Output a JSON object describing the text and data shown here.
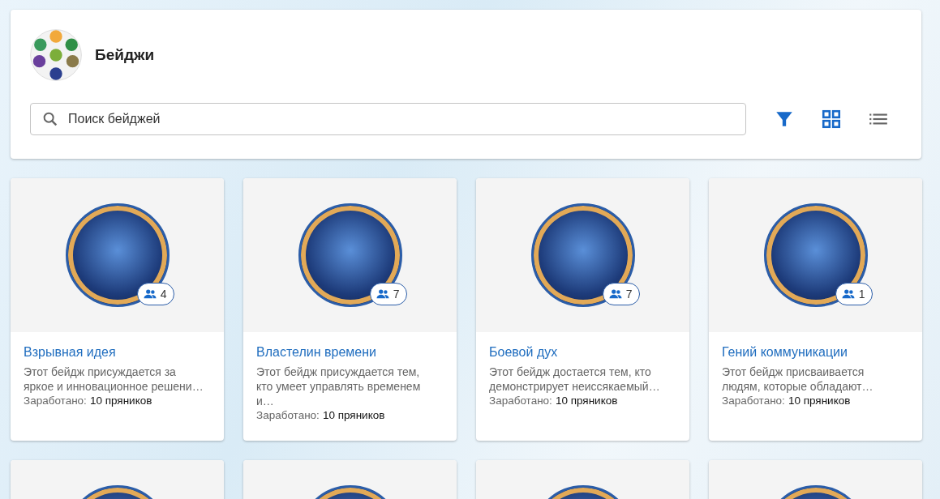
{
  "header": {
    "title": "Бейджи",
    "search": {
      "placeholder": "Поиск бейджей"
    },
    "view_buttons": [
      {
        "kind": "grid",
        "selected": true
      },
      {
        "kind": "list",
        "selected": false
      }
    ]
  },
  "badges": [
    {
      "kind": "full",
      "members": "4",
      "title": "Взрывная идея",
      "description": "Этот бейдж присуждается за яркое и инновационное решени…",
      "earned_label": "Заработано:",
      "earned_value": "10 пряников"
    },
    {
      "kind": "full",
      "members": "7",
      "title": "Властелин времени",
      "description": "Этот бейдж присуждается тем, кто умеет управлять временем и…",
      "earned_label": "Заработано:",
      "earned_value": "10 пряников"
    },
    {
      "kind": "full",
      "members": "7",
      "title": "Боевой дух",
      "description": "Этот бейдж достается тем, кто демонстрирует неиссякаемый…",
      "earned_label": "Заработано:",
      "earned_value": "10 пряников"
    },
    {
      "kind": "full",
      "members": "1",
      "title": "Гений коммуникации",
      "description": "Этот бейдж присваивается людям, которые обладают…",
      "earned_label": "Заработано:",
      "earned_value": "10 пряников"
    },
    {
      "kind": "cut"
    },
    {
      "kind": "cut"
    },
    {
      "kind": "cut"
    },
    {
      "kind": "cut"
    }
  ]
}
